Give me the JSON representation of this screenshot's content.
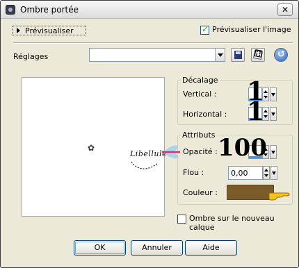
{
  "window": {
    "title": "Ombre portée",
    "close_symbol": "✕"
  },
  "topbar": {
    "preview_toggle_label": "Prévisualiser",
    "preview_image_label": "Prévisualiser l'image",
    "preview_image_checked": true
  },
  "settings": {
    "label": "Réglages",
    "value": ""
  },
  "offset_group": {
    "title": "Décalage",
    "vertical_label": "Vertical :",
    "vertical_value": "",
    "horizontal_label": "Horizontal :",
    "horizontal_value": ""
  },
  "attributes_group": {
    "title": "Attributs",
    "opacity_label": "Opacité :",
    "opacity_value": "",
    "blur_label": "Flou :",
    "blur_value": "0,00",
    "color_label": "Couleur :",
    "color_hex": "#7a5c2a"
  },
  "annotations": {
    "vertical": "1",
    "horizontal": "1",
    "opacity": "100"
  },
  "watermark_text": "Libellule",
  "new_layer": {
    "label": "Ombre sur le nouveau calque",
    "checked": false
  },
  "buttons": {
    "ok": "OK",
    "cancel": "Annuler",
    "help": "Aide"
  }
}
